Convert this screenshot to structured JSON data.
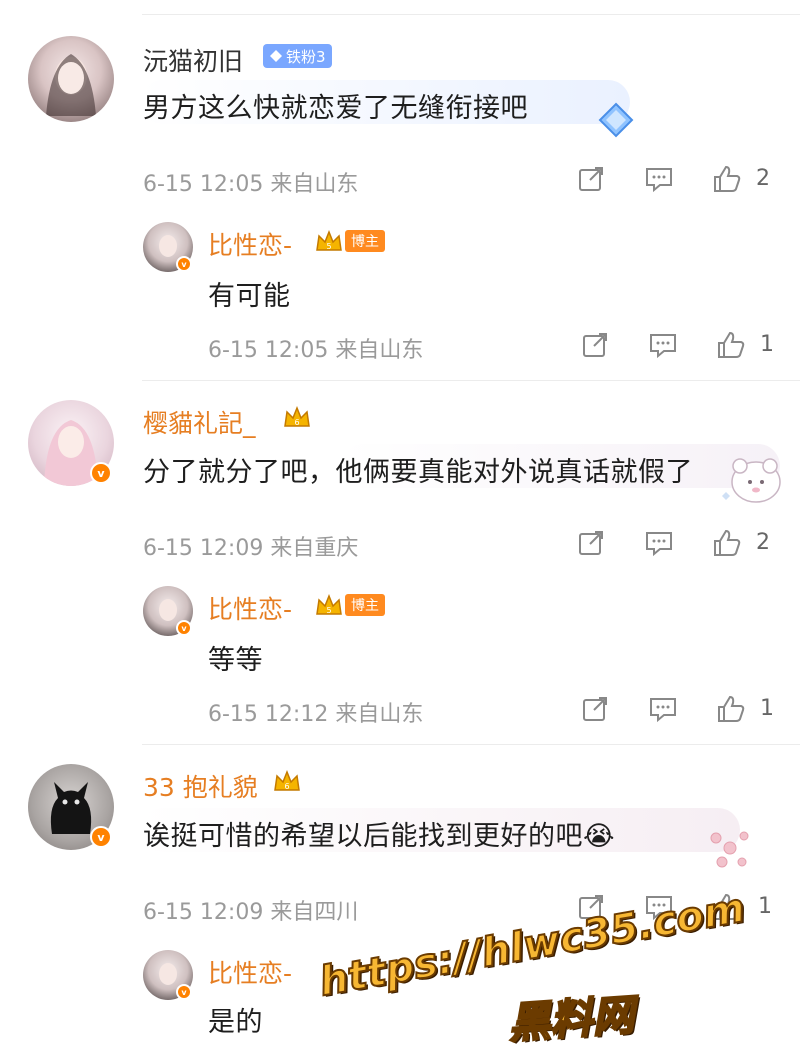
{
  "comments": [
    {
      "user": "沅猫初旧",
      "badge": "铁粉3",
      "text": "男方这么快就恋爱了无缝衔接吧",
      "meta": "6-15 12:05 来自山东",
      "likes": "2",
      "reply": {
        "user": "比性恋-",
        "tag": "博主",
        "text": "有可能",
        "meta": "6-15 12:05 来自山东",
        "likes": "1"
      }
    },
    {
      "user": "樱貓礼記_",
      "text": "分了就分了吧，他俩要真能对外说真话就假了",
      "meta": "6-15 12:09 来自重庆",
      "likes": "2",
      "reply": {
        "user": "比性恋-",
        "tag": "博主",
        "text": "等等",
        "meta": "6-15 12:12 来自山东",
        "likes": "1"
      }
    },
    {
      "user": "33 抱礼貌",
      "text": "诶挺可惜的希望以后能找到更好的吧",
      "emoji": "😭",
      "meta": "6-15 12:09 来自四川",
      "likes": "1",
      "reply": {
        "user": "比性恋-",
        "text": "是的"
      }
    }
  ],
  "watermark": {
    "url": "https://hlwc35.com",
    "label": "黑料网"
  },
  "colors": {
    "orange": "#ff8200",
    "name_orange": "#e67e22",
    "fan_badge": "#7aa7ff"
  },
  "icons": [
    "repost-icon",
    "comment-icon",
    "like-icon",
    "verified-icon",
    "crown-icon"
  ]
}
